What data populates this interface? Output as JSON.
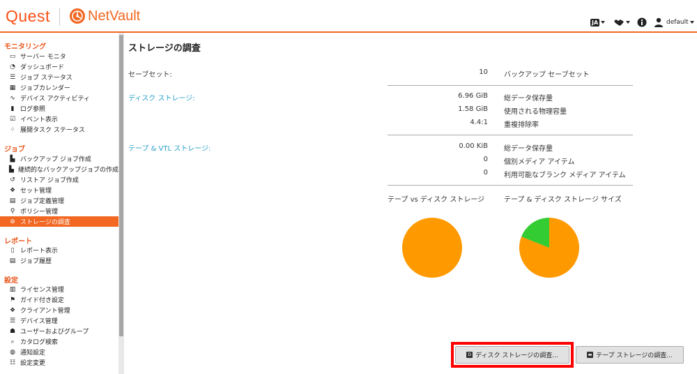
{
  "header": {
    "brand": "Quest",
    "product": "NetVault",
    "lang_badge": "JA",
    "user": "default"
  },
  "sidebar": {
    "sections": [
      {
        "title": "モニタリング",
        "items": [
          {
            "label": "サーバー モニタ",
            "icon": "monitor-icon"
          },
          {
            "label": "ダッシュボード",
            "icon": "gauge-icon"
          },
          {
            "label": "ジョブ ステータス",
            "icon": "job-status-icon"
          },
          {
            "label": "ジョブカレンダー",
            "icon": "calendar-icon"
          },
          {
            "label": "デバイス アクティビティ",
            "icon": "activity-icon"
          },
          {
            "label": "ログ参照",
            "icon": "log-icon"
          },
          {
            "label": "イベント表示",
            "icon": "event-icon"
          },
          {
            "label": "展開タスク ステータス",
            "icon": "deploy-spinner-icon"
          }
        ]
      },
      {
        "title": "ジョブ",
        "items": [
          {
            "label": "バックアップ ジョブ作成",
            "icon": "backup-job-icon"
          },
          {
            "label": "継続的なバックアップジョブの作成",
            "icon": "continuous-backup-icon"
          },
          {
            "label": "リストア ジョブ作成",
            "icon": "restore-icon"
          },
          {
            "label": "セット管理",
            "icon": "sets-icon"
          },
          {
            "label": "ジョブ定義管理",
            "icon": "job-definition-icon"
          },
          {
            "label": "ポリシー管理",
            "icon": "policy-icon"
          },
          {
            "label": "ストレージの調査",
            "icon": "storage-explore-icon"
          }
        ]
      },
      {
        "title": "レポート",
        "items": [
          {
            "label": "レポート表示",
            "icon": "report-icon"
          },
          {
            "label": "ジョブ履歴",
            "icon": "history-icon"
          }
        ]
      },
      {
        "title": "設定",
        "items": [
          {
            "label": "ライセンス管理",
            "icon": "license-icon"
          },
          {
            "label": "ガイド付き設定",
            "icon": "guided-config-icon"
          },
          {
            "label": "クライアント管理",
            "icon": "client-icon"
          },
          {
            "label": "デバイス管理",
            "icon": "device-icon"
          },
          {
            "label": "ユーザーおよびグループ",
            "icon": "users-icon"
          },
          {
            "label": "カタログ検索",
            "icon": "catalog-search-icon"
          },
          {
            "label": "通知設定",
            "icon": "notification-icon"
          },
          {
            "label": "設定変更",
            "icon": "settings-icon"
          }
        ]
      }
    ]
  },
  "main": {
    "title": "ストレージの調査",
    "save_sets": {
      "label": "セーブセット:",
      "value": "10",
      "desc": "バックアップ セーブセット"
    },
    "disk": {
      "label": "ディスク ストレージ:",
      "rows": [
        {
          "value": "6.96 GiB",
          "desc": "総データ保存量"
        },
        {
          "value": "1.58 GiB",
          "desc": "使用される物理容量"
        },
        {
          "value": "4.4:1",
          "desc": "重複排除率"
        }
      ]
    },
    "tape": {
      "label": "テープ & VTL ストレージ:",
      "rows": [
        {
          "value": "0.00 KiB",
          "desc": "総データ保存量"
        },
        {
          "value": "0",
          "desc": "個別メディア アイテム"
        },
        {
          "value": "0",
          "desc": "利用可能なブランク メディア アイテム"
        }
      ]
    },
    "charts": [
      {
        "title": "テープ vs ディスク ストレージ"
      },
      {
        "title": "テープ & ディスク ストレージ サイズ"
      }
    ]
  },
  "chart_data": [
    {
      "type": "pie",
      "title": "テープ vs ディスク ストレージ",
      "labels": [],
      "values": [
        1.0
      ],
      "colors": [
        "#ff9900"
      ]
    },
    {
      "type": "pie",
      "title": "テープ & ディスク ストレージ サイズ",
      "labels": [],
      "values": [
        0.81,
        0.19
      ],
      "colors": [
        "#ff9900",
        "#33cc33"
      ]
    }
  ],
  "buttons": {
    "explore_disk": "ディスク ストレージの調査...",
    "explore_tape": "テープ ストレージの調査..."
  },
  "colors": {
    "accent": "#f26722",
    "link": "#2aa0c9",
    "highlight": "#ff0000"
  }
}
